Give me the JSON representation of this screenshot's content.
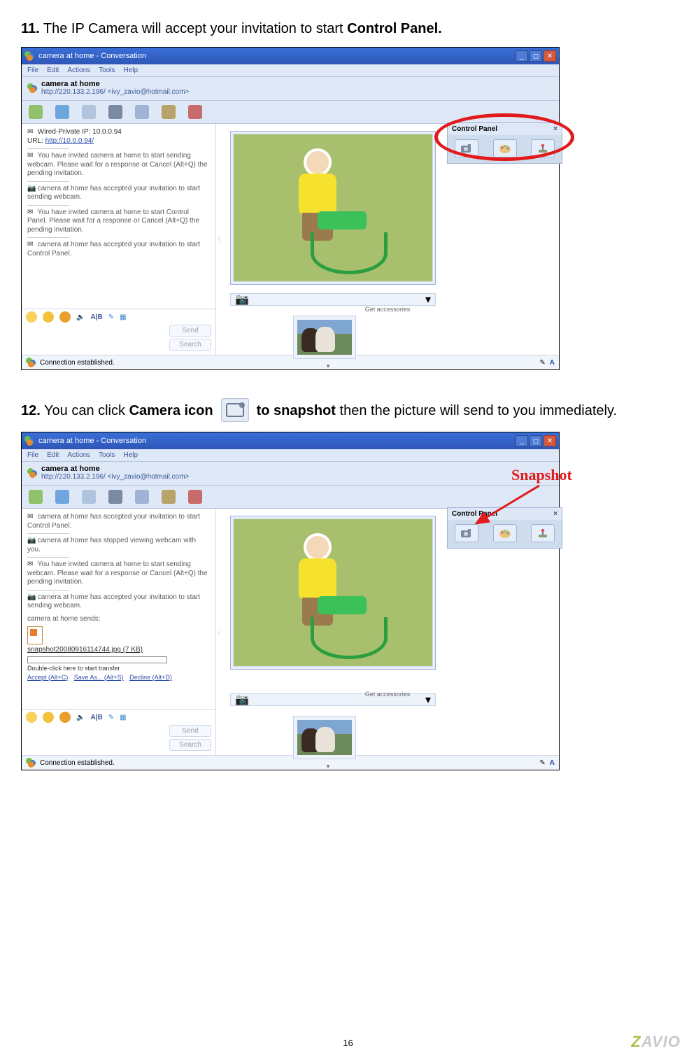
{
  "steps": {
    "s11": {
      "num": "11.",
      "pre": " The IP Camera will accept your invitation to start ",
      "bold": "Control Panel."
    },
    "s12": {
      "num": "12.",
      "pre": " You can click ",
      "b1": "Camera icon",
      "mid": " to snapshot",
      "post": " then the picture will send to you immediately."
    }
  },
  "window": {
    "title": "camera at home - Conversation",
    "menubar": [
      "File",
      "Edit",
      "Actions",
      "Tools",
      "Help"
    ],
    "contact": {
      "name": "camera at home",
      "url": "http://220.133.2.196/ <ivy_zavio@hotmail.com>"
    },
    "buttons": {
      "send": "Send",
      "search": "Search"
    },
    "status": "Connection established.",
    "getacc": "Get accessories",
    "thumbctrl": "▾"
  },
  "chat1": {
    "l1a": "Wired-Private IP: 10.0.0.94",
    "l1b": "URL: ",
    "l1burl": "http://10.0.0.94/",
    "l2": "You have invited camera at home to start sending webcam. Please wait for a response or Cancel (Alt+Q) the pending invitation.",
    "l3": "camera at home has accepted your invitation to start sending webcam.",
    "l4": "You have invited camera at home to start Control Panel. Please wait for a response or Cancel (Alt+Q) the pending invitation.",
    "l5": "camera at home has accepted your invitation to start Control Panel."
  },
  "chat2": {
    "l1": "camera at home has accepted your invitation to start Control Panel.",
    "l2": "camera at home has stopped viewing webcam with you.",
    "l3": "You have invited camera at home to start sending webcam. Please wait for a response or Cancel (Alt+Q) the pending invitation.",
    "l4": "camera at home has accepted your invitation to start sending webcam.",
    "l5": "camera at home sends:",
    "file": "snapshot20080916114744.jpg (7 KB)",
    "dbl": "Double-click here to start transfer",
    "acc": "Accept (Alt+C)",
    "sav": "Save As... (Alt+S)",
    "dec": "Decline (Alt+D)"
  },
  "cpanel": {
    "title": "Control Panel",
    "close": "×",
    "icons": [
      "camera-icon",
      "palette-icon",
      "joystick-icon"
    ]
  },
  "annot": {
    "snapshot": "Snapshot"
  },
  "page": {
    "num": "16",
    "brand_pre": "Z",
    "brand_post": "AVIO"
  }
}
